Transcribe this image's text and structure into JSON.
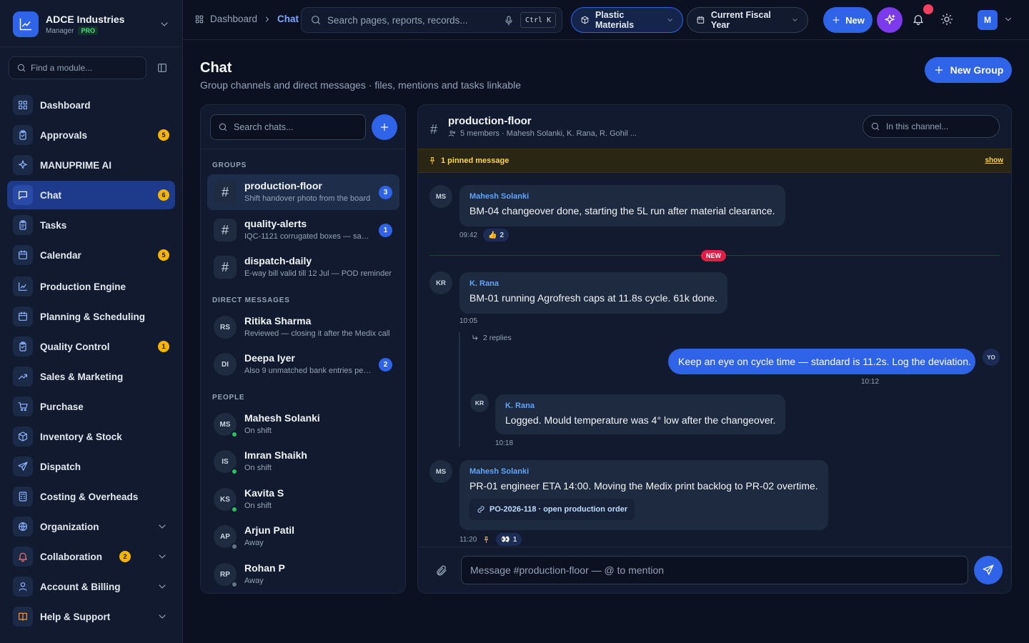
{
  "brand": {
    "name": "ADCE Industries",
    "role": "Manager",
    "tier": "PRO"
  },
  "sidebar": {
    "find_placeholder": "Find a module...",
    "items": [
      {
        "label": "Dashboard",
        "icon": "grid-icon"
      },
      {
        "label": "Approvals",
        "icon": "clipboard-icon",
        "badge": "5"
      },
      {
        "label": "MANUPRIME AI",
        "icon": "sparkles-icon"
      },
      {
        "label": "Chat",
        "icon": "chat-icon",
        "badge": "6",
        "active": true
      },
      {
        "label": "Tasks",
        "icon": "clipboard-icon"
      },
      {
        "label": "Calendar",
        "icon": "calendar-icon",
        "badge": "5"
      },
      {
        "label": "Production Engine",
        "icon": "chart-icon"
      },
      {
        "label": "Planning & Scheduling",
        "icon": "calendar-icon"
      },
      {
        "label": "Quality Control",
        "icon": "clipboard-icon",
        "badge": "1"
      },
      {
        "label": "Sales & Marketing",
        "icon": "trend-icon"
      },
      {
        "label": "Purchase",
        "icon": "cart-icon"
      },
      {
        "label": "Inventory & Stock",
        "icon": "box-icon"
      },
      {
        "label": "Dispatch",
        "icon": "send-icon"
      },
      {
        "label": "Costing & Overheads",
        "icon": "calculator-icon"
      },
      {
        "label": "Organization",
        "icon": "globe-icon",
        "expandable": true
      },
      {
        "label": "Collaboration",
        "icon": "bell-icon",
        "badge": "2",
        "expandable": true
      },
      {
        "label": "Account & Billing",
        "icon": "user-icon",
        "expandable": true
      },
      {
        "label": "Help & Support",
        "icon": "book-icon",
        "expandable": true
      }
    ]
  },
  "topbar": {
    "crumbs": [
      "Dashboard",
      "Chat"
    ],
    "search_placeholder": "Search pages, reports, records...",
    "shortcut": "Ctrl K",
    "material_filter": "Plastic Materials",
    "period_filter": "Current Fiscal Year",
    "new_label": "New",
    "user_initial": "M"
  },
  "page": {
    "title": "Chat",
    "subtitle": "Group channels and direct messages · files, mentions and tasks linkable",
    "new_group_label": "New Group"
  },
  "chatlist": {
    "search_placeholder": "Search chats...",
    "groups_label": "GROUPS",
    "groups": [
      {
        "title": "production-floor",
        "preview": "Shift handover photo from the board",
        "unread": "3"
      },
      {
        "title": "quality-alerts",
        "preview": "IQC-1121 corrugated boxes — sample failed",
        "unread": "1"
      },
      {
        "title": "dispatch-daily",
        "preview": "E-way bill valid till 12 Jul — POD reminder"
      }
    ],
    "dm_label": "DIRECT MESSAGES",
    "dms": [
      {
        "initials": "RS",
        "name": "Ritika Sharma",
        "preview": "Reviewed — closing it after the Medix call"
      },
      {
        "initials": "DI",
        "name": "Deepa Iyer",
        "preview": "Also 9 unmatched bank entries pending",
        "unread": "2"
      }
    ],
    "people_label": "PEOPLE",
    "people": [
      {
        "initials": "MS",
        "name": "Mahesh Solanki",
        "status": "On shift",
        "online": true
      },
      {
        "initials": "IS",
        "name": "Imran Shaikh",
        "status": "On shift",
        "online": true
      },
      {
        "initials": "KS",
        "name": "Kavita S",
        "status": "On shift",
        "online": true
      },
      {
        "initials": "AP",
        "name": "Arjun Patil",
        "status": "Away",
        "online": false
      },
      {
        "initials": "RP",
        "name": "Rohan P",
        "status": "Away",
        "online": false
      }
    ]
  },
  "channel": {
    "name": "production-floor",
    "members": "5 members · Mahesh Solanki, K. Rana, R. Gohil ...",
    "search_placeholder": "In this channel...",
    "pinned_text": "1 pinned message",
    "pinned_action": "show",
    "new_divider": "NEW",
    "messages": [
      {
        "initials": "MS",
        "author": "Mahesh Solanki",
        "text": "BM-04 changeover done, starting the 5L run after material clearance.",
        "time": "09:42",
        "reaction": "2"
      },
      {
        "initials": "KR",
        "author": "K. Rana",
        "text": "BM-01 running Agrofresh caps at 11.8s cycle. 61k done.",
        "time": "10:05",
        "replies": "2 replies"
      },
      {
        "initials": "YO",
        "text": "Keep an eye on cycle time — standard is 11.2s. Log the deviation.",
        "time": "10:12"
      },
      {
        "initials": "KR",
        "author": "K. Rana",
        "text": "Logged. Mould temperature was 4° low after the changeover.",
        "time": "10:18"
      },
      {
        "initials": "MS",
        "author": "Mahesh Solanki",
        "text": "PR-01 engineer ETA 14:00. Moving the Medix print backlog to PR-02 overtime.",
        "link": "PO-2026-118 · open production order",
        "time": "11:20",
        "reaction": "1"
      }
    ],
    "composer_placeholder": "Message #production-floor — @ to mention"
  },
  "colors": {
    "accent": "#2f63e8",
    "ai": "#7c3aed",
    "badge": "#f5b400",
    "online": "#22c55e",
    "new": "#e11d48"
  }
}
